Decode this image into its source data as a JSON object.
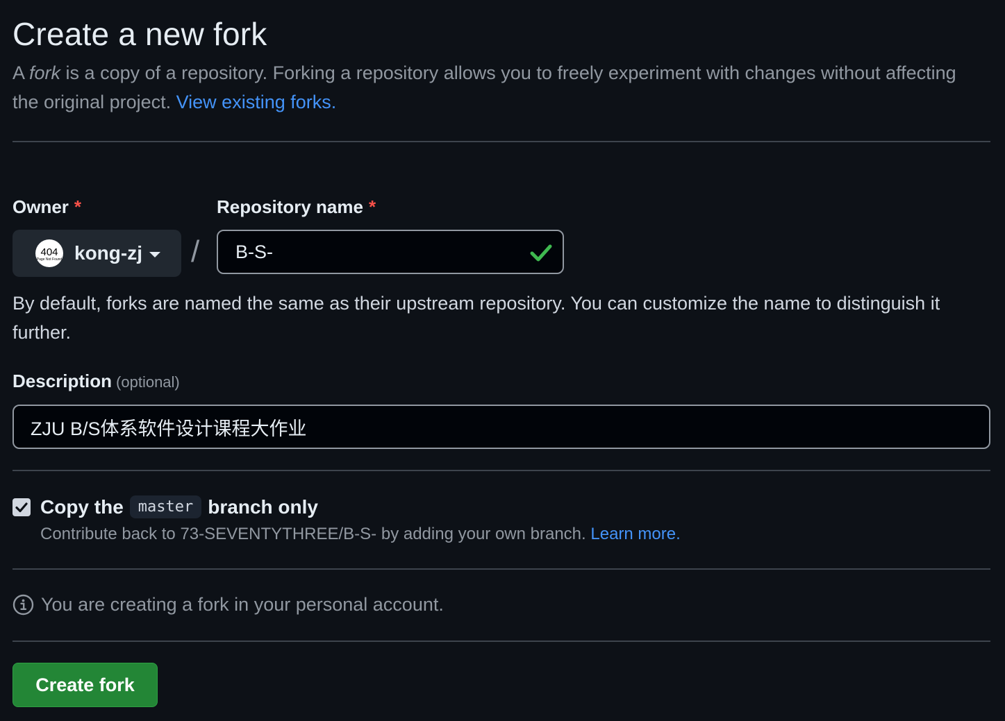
{
  "header": {
    "title": "Create a new fork",
    "intro_prefix": "A ",
    "intro_em": "fork",
    "intro_suffix": " is a copy of a repository. Forking a repository allows you to freely experiment with changes without affecting the original project. ",
    "view_forks_link": "View existing forks."
  },
  "owner": {
    "label": "Owner",
    "required_mark": "*",
    "value": "kong-zj",
    "avatar_text": "404",
    "avatar_subtext": "Page Not Found"
  },
  "separator": "/",
  "repository": {
    "label": "Repository name",
    "required_mark": "*",
    "value": "B-S-",
    "valid_icon": "check-icon"
  },
  "name_hint": "By default, forks are named the same as their upstream repository. You can customize the name to distinguish it further.",
  "description": {
    "label": "Description",
    "optional_label": "(optional)",
    "value": "ZJU B/S体系软件设计课程大作业"
  },
  "copy_branch": {
    "checked": true,
    "label_before": "Copy the",
    "branch": "master",
    "label_after": "branch only",
    "contribute_text": "Contribute back to 73-SEVENTYTHREE/B-S- by adding your own branch. ",
    "learn_more_link": "Learn more."
  },
  "info": {
    "icon": "info-icon",
    "text": "You are creating a fork in your personal account."
  },
  "submit": {
    "label": "Create fork"
  },
  "colors": {
    "background": "#0d1117",
    "link": "#4493f8",
    "primary_button": "#238636",
    "required": "#f85149",
    "success": "#3fb950"
  }
}
